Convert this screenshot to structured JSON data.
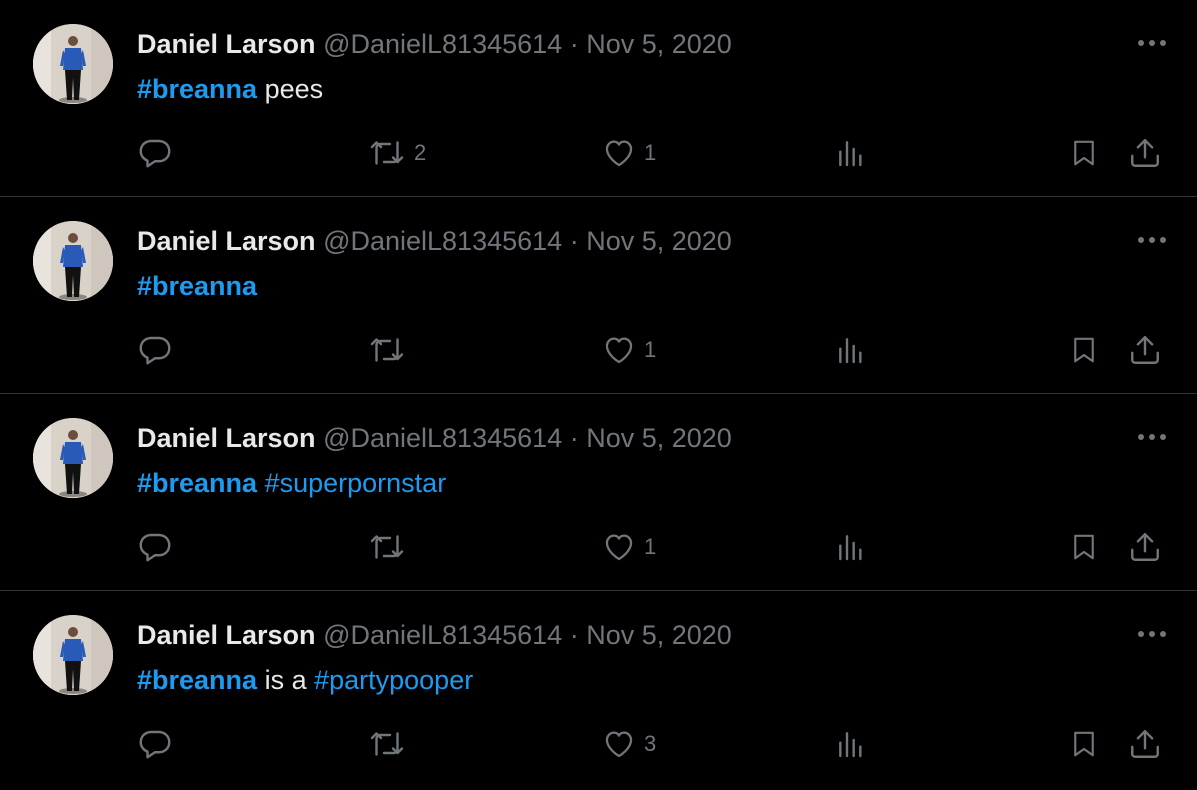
{
  "colors": {
    "background": "#000000",
    "text": "#e7e9ea",
    "muted": "#71767b",
    "hashtag": "#1d9bf0",
    "divider": "#2f3336"
  },
  "tweets": [
    {
      "name": "Daniel Larson",
      "handle": "@DanielL81345614",
      "dot": "·",
      "date": "Nov 5, 2020",
      "text": [
        {
          "text": "#breanna",
          "kind": "hashtag-strong"
        },
        {
          "text": " pees",
          "kind": "plain"
        }
      ],
      "retweets": "2",
      "likes": "1"
    },
    {
      "name": "Daniel Larson",
      "handle": "@DanielL81345614",
      "dot": "·",
      "date": "Nov 5, 2020",
      "text": [
        {
          "text": "#breanna",
          "kind": "hashtag-strong"
        }
      ],
      "retweets": "",
      "likes": "1"
    },
    {
      "name": "Daniel Larson",
      "handle": "@DanielL81345614",
      "dot": "·",
      "date": "Nov 5, 2020",
      "text": [
        {
          "text": "#breanna",
          "kind": "hashtag-strong"
        },
        {
          "text": " ",
          "kind": "plain"
        },
        {
          "text": "#superpornstar",
          "kind": "hashtag"
        }
      ],
      "retweets": "",
      "likes": "1"
    },
    {
      "name": "Daniel Larson",
      "handle": "@DanielL81345614",
      "dot": "·",
      "date": "Nov 5, 2020",
      "text": [
        {
          "text": "#breanna",
          "kind": "hashtag-strong"
        },
        {
          "text": " is a ",
          "kind": "plain"
        },
        {
          "text": "#partypooper",
          "kind": "hashtag"
        }
      ],
      "retweets": "",
      "likes": "3"
    }
  ],
  "icons": {
    "more": "more-dots-icon",
    "reply": "reply-bubble-icon",
    "retweet": "retweet-arrows-icon",
    "like": "heart-icon",
    "views": "views-bar-chart-icon",
    "bookmark": "bookmark-icon",
    "share": "share-upload-icon"
  }
}
